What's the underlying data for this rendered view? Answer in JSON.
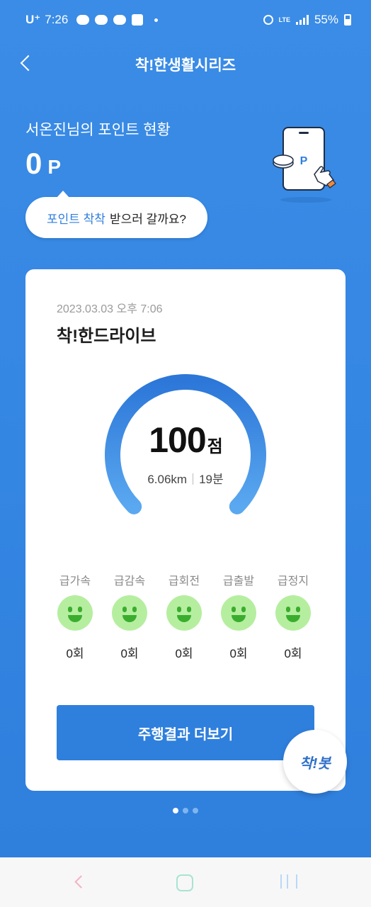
{
  "status_bar": {
    "carrier": "U⁺",
    "time": "7:26",
    "lte": "LTE",
    "battery": "55%"
  },
  "header": {
    "title": "착!한생활시리즈"
  },
  "points": {
    "label": "서온진님의 포인트 현황",
    "value": "0",
    "unit": "P"
  },
  "bubble": {
    "highlight": "포인트 착착",
    "rest": "받으러 갈까요?"
  },
  "card": {
    "date": "2023.03.03 오후 7:06",
    "title": "착!한드라이브",
    "score": "100",
    "score_unit": "점",
    "score_fraction": 1.0,
    "distance": "6.06km",
    "duration": "19분",
    "events": [
      {
        "label": "급가속",
        "count": "0회"
      },
      {
        "label": "급감속",
        "count": "0회"
      },
      {
        "label": "급회전",
        "count": "0회"
      },
      {
        "label": "급출발",
        "count": "0회"
      },
      {
        "label": "급정지",
        "count": "0회"
      }
    ],
    "more_button": "주행결과 더보기"
  },
  "chatbot": {
    "label": "착!봇"
  },
  "pager": {
    "total": 3,
    "active": 1
  },
  "illustration": {
    "phone_letter": "P"
  },
  "colors": {
    "primary": "#2f7fdd",
    "face_green": "#b6eea0",
    "face_feature": "#3aad2e"
  },
  "icons": {
    "back": "chevron-left-icon",
    "alarm": "alarm-icon",
    "signal": "signal-icon",
    "battery": "battery-icon"
  }
}
